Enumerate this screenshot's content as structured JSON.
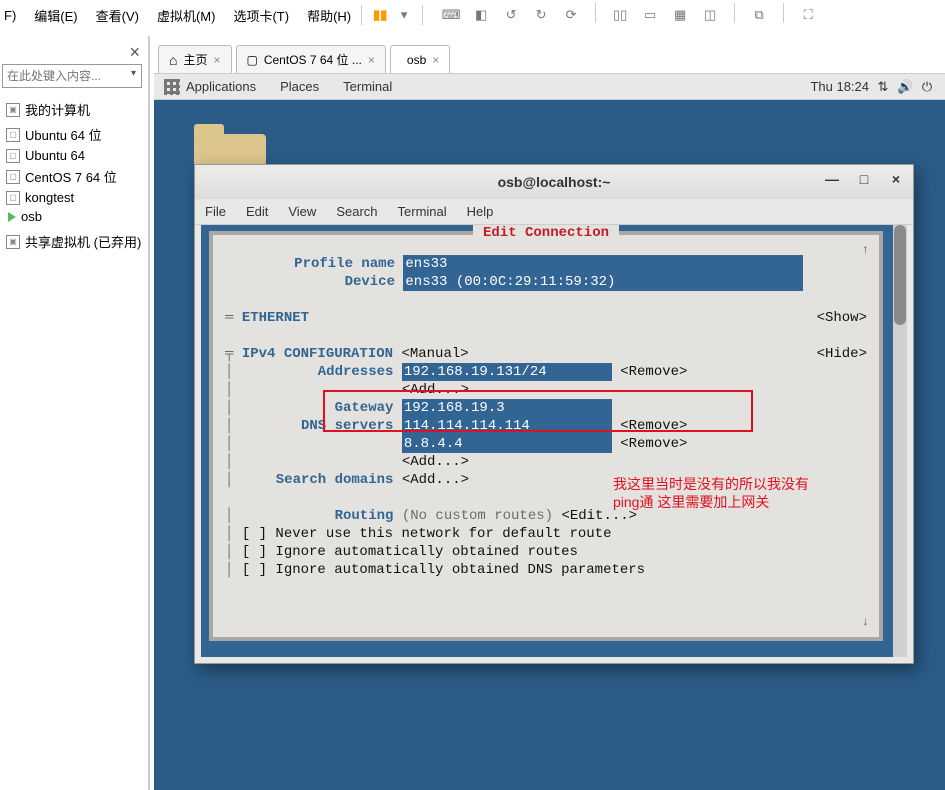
{
  "host_menu": {
    "file": "F)",
    "edit": "编辑(E)",
    "view": "查看(V)",
    "vm": "虚拟机(M)",
    "tabs": "选项卡(T)",
    "help": "帮助(H)"
  },
  "sidebar": {
    "search_placeholder": "在此处键入内容...",
    "root": "我的计算机",
    "items": [
      "Ubuntu 64 位",
      "Ubuntu 64",
      "CentOS 7 64 位",
      "kongtest",
      "osb"
    ],
    "shared": "共享虚拟机 (已弃用)"
  },
  "tabs": {
    "home": "主页",
    "centos": "CentOS 7 64 位 ...",
    "osb": "osb"
  },
  "gnome": {
    "apps": "Applications",
    "places": "Places",
    "terminal": "Terminal",
    "clock": "Thu 18:24"
  },
  "window": {
    "title": "osb@localhost:~",
    "menu": {
      "file": "File",
      "edit": "Edit",
      "view": "View",
      "search": "Search",
      "terminal": "Terminal",
      "help": "Help"
    }
  },
  "tui": {
    "title": "Edit Connection",
    "profile_label": "Profile name",
    "profile_value": "ens33",
    "device_label": "Device",
    "device_value": "ens33 (00:0C:29:11:59:32)",
    "eth": "ETHERNET",
    "show": "<Show>",
    "ipv4": "IPv4 CONFIGURATION",
    "manual": "<Manual>",
    "hide": "<Hide>",
    "addresses_label": "Addresses",
    "addr_val": "192.168.19.131/24",
    "remove": "<Remove>",
    "add": "<Add...>",
    "gateway_label": "Gateway",
    "gateway_val": "192.168.19.3",
    "dns_label": "DNS servers",
    "dns1": "114.114.114.114",
    "dns2": "8.8.4.4",
    "search_label": "Search domains",
    "routing_label": "Routing",
    "routing_val": "(No custom routes)",
    "edit": "<Edit...>",
    "cb1": "[ ] Never use this network for default route",
    "cb2": "[ ] Ignore automatically obtained routes",
    "cb3": "[ ] Ignore automatically obtained DNS parameters"
  },
  "annotation": {
    "line1": "我这里当时是没有的所以我没有",
    "line2": "ping通 这里需要加上网关"
  }
}
